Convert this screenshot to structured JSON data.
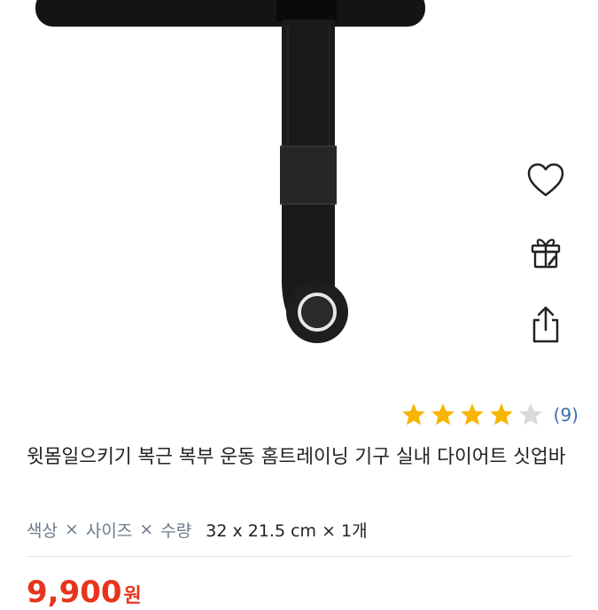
{
  "product": {
    "image_alt": "sit-up bar product photo",
    "title": "윗몸일으키기 복근 복부 운동 홈트레이닝 기구 실내 다이어트 싯업바",
    "rating": {
      "stars": 4,
      "max_stars": 5,
      "review_count": "(9)",
      "filled_color": "#f7b500",
      "empty_color": "#d9d9d9"
    },
    "options": {
      "keys": [
        "색상",
        "사이즈",
        "수량"
      ],
      "separator": "×",
      "value": "32 x 21.5 cm × 1개"
    },
    "price": {
      "amount": "9,900",
      "unit": "원",
      "color": "#e8341c"
    }
  },
  "actions": {
    "like_icon": "heart-outline-icon",
    "gift_icon": "gift-icon",
    "share_icon": "share-icon"
  }
}
